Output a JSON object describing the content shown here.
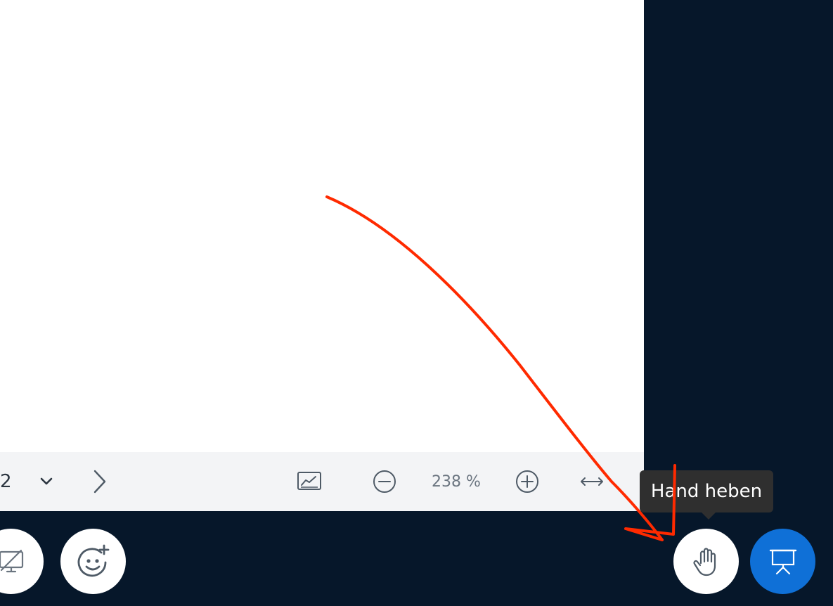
{
  "toolbar": {
    "page_number": "2",
    "zoom_value": "238 %"
  },
  "tooltip": {
    "label": "Hand heben"
  },
  "icons": {
    "chevron": "chevron-down-icon",
    "next": "chevron-right-icon",
    "whiteboard": "whiteboard-icon",
    "zoom_out": "zoom-out-icon",
    "zoom_in": "zoom-in-icon",
    "fit_width": "fit-width-icon",
    "screen_share": "screen-share-off-icon",
    "emoji": "emoji-add-icon",
    "raise_hand": "raise-hand-icon",
    "presentation": "presentation-icon"
  },
  "colors": {
    "background": "#06172a",
    "accent": "#0f70d7",
    "annotation": "#ff2a00"
  }
}
